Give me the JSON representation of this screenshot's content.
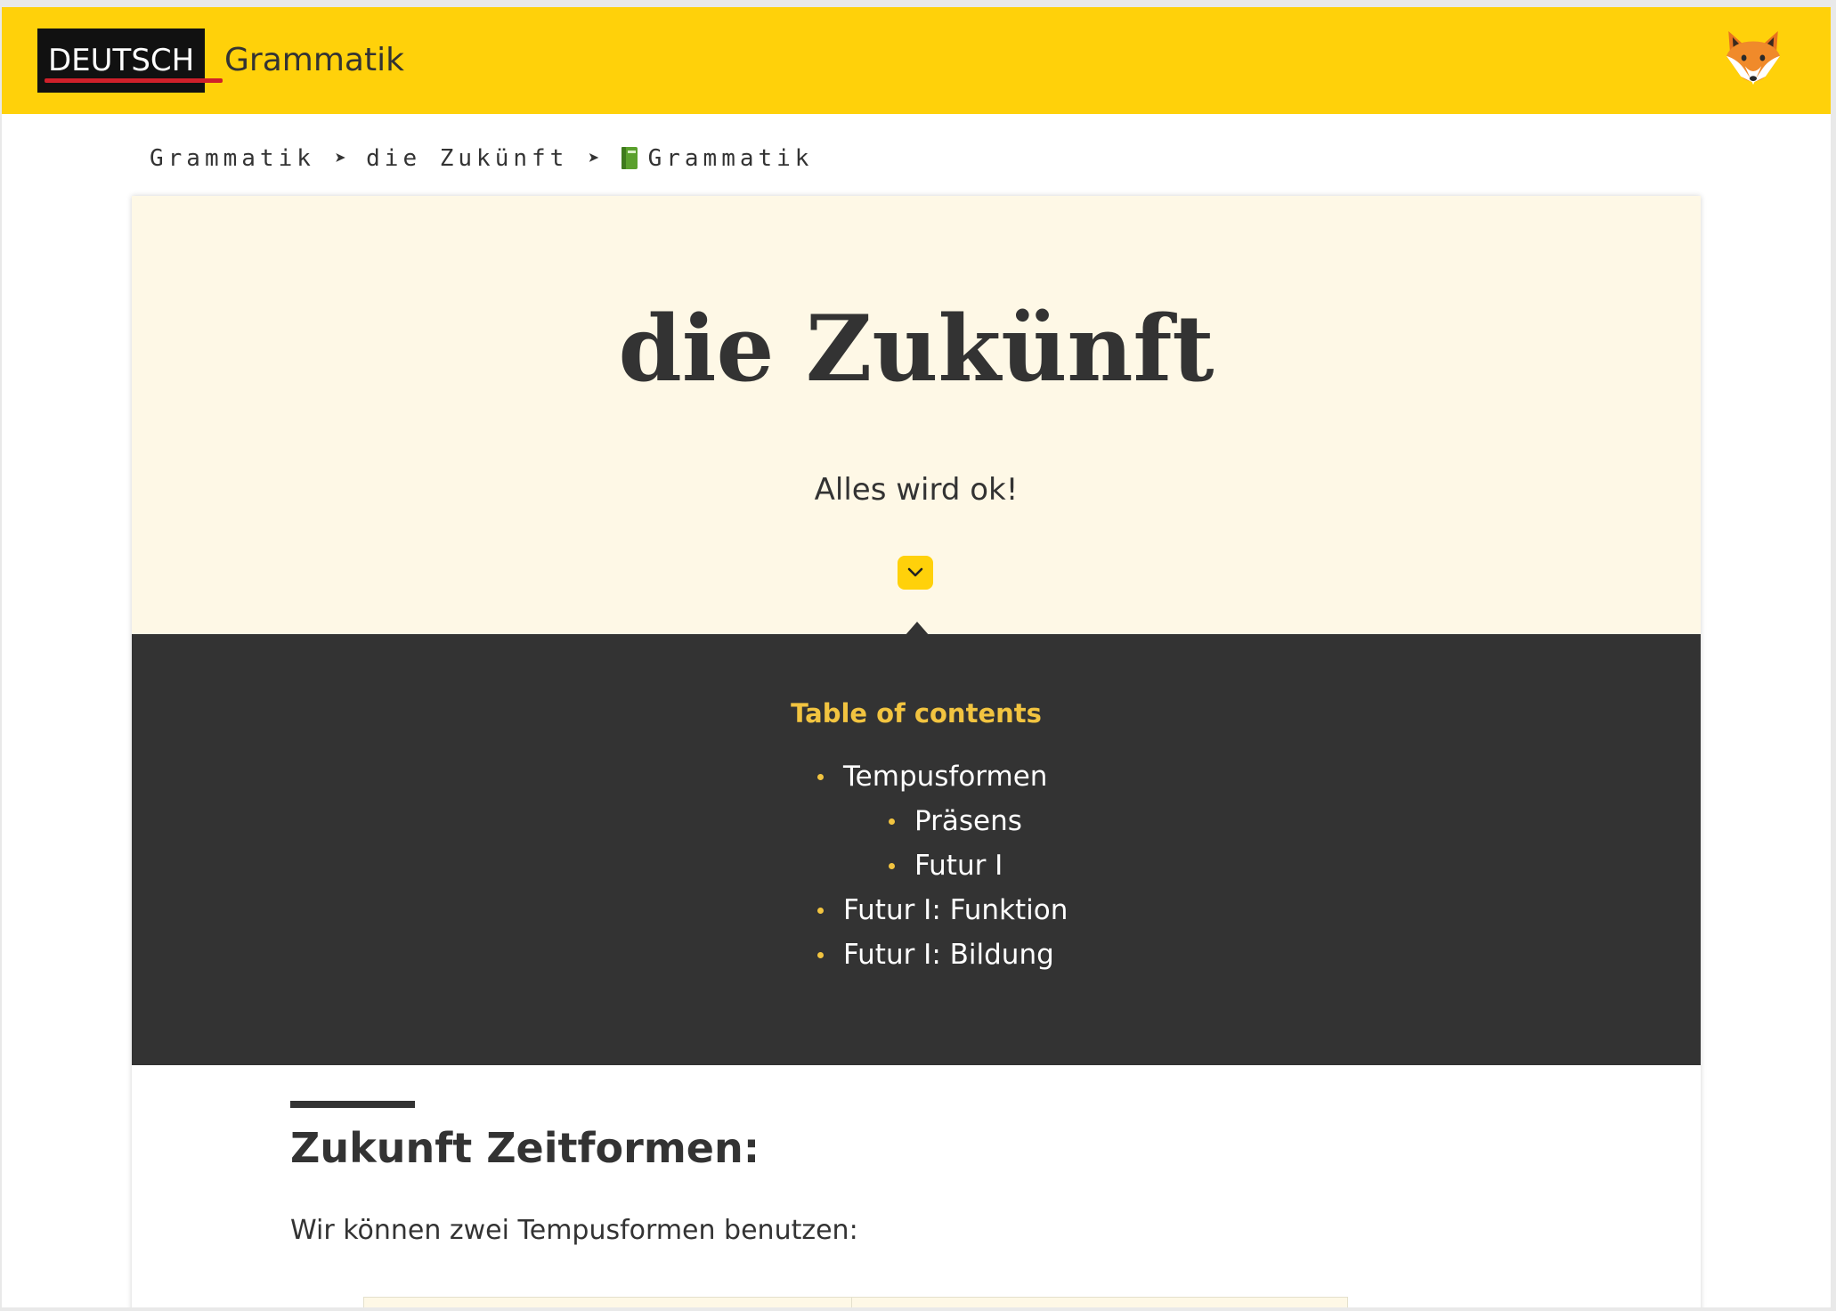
{
  "header": {
    "logo_box_text": "DEUTSCH",
    "logo_text": "Grammatik",
    "avatar_icon": "fox-face-icon",
    "bar_color": "#ffd10a"
  },
  "breadcrumb": {
    "items": [
      "Grammatik",
      "die Zukünft",
      "Grammatik"
    ],
    "separator": "➤",
    "last_item_icon": "green-book-icon"
  },
  "hero": {
    "title": "die Zukünft",
    "subtitle": "Alles wird ok!",
    "toggle_icon": "chevron-down-icon"
  },
  "toc": {
    "title": "Table of contents",
    "items": [
      {
        "label": "Tempusformen",
        "level": 1
      },
      {
        "label": "Präsens",
        "level": 2
      },
      {
        "label": "Futur I",
        "level": 2
      },
      {
        "label": "Futur I: Funktion",
        "level": 1
      },
      {
        "label": "Futur I: Bildung",
        "level": 1
      }
    ],
    "accent_color": "#f2c440",
    "background_color": "#333333"
  },
  "content": {
    "heading": "Zukunft Zeitformen:",
    "paragraph": "Wir können zwei Tempusformen benutzen:"
  }
}
